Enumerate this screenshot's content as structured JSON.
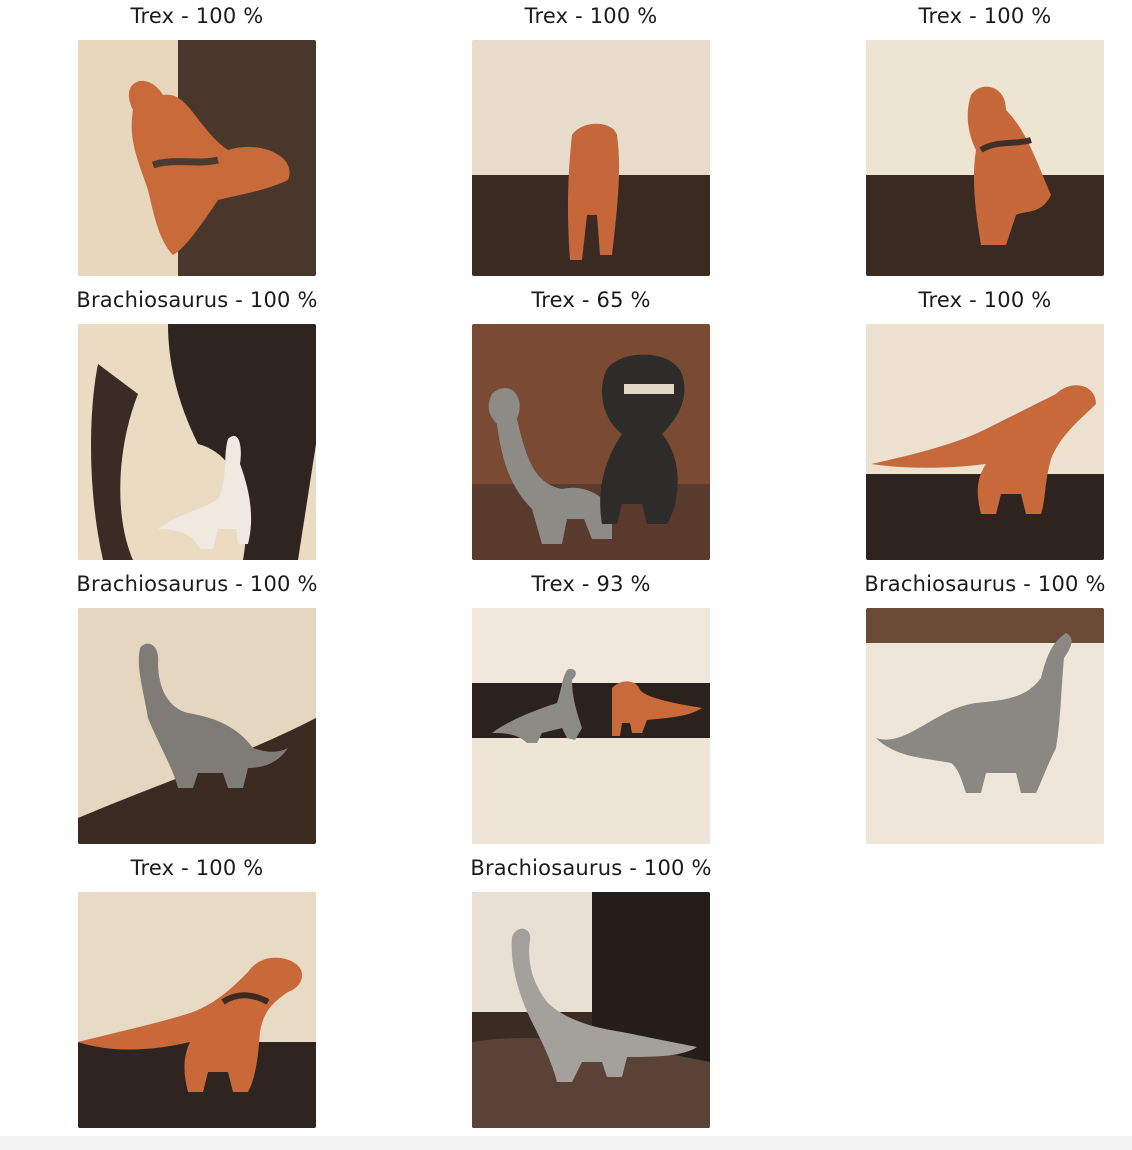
{
  "grid": {
    "items": [
      {
        "caption": "Trex - 100 %"
      },
      {
        "caption": "Trex - 100 %"
      },
      {
        "caption": "Trex - 100 %"
      },
      {
        "caption": "Brachiosaurus - 100 %"
      },
      {
        "caption": "Trex - 65 %"
      },
      {
        "caption": "Trex - 100 %"
      },
      {
        "caption": "Brachiosaurus - 100 %"
      },
      {
        "caption": "Trex - 93 %"
      },
      {
        "caption": "Brachiosaurus - 100 %"
      },
      {
        "caption": "Trex - 100 %"
      },
      {
        "caption": "Brachiosaurus - 100 %"
      }
    ]
  },
  "colors": {
    "trex": "#c8683a",
    "brachio": "#8f8c86",
    "floor_dark": "#3b2a22",
    "wall_light": "#e9dcc6"
  }
}
